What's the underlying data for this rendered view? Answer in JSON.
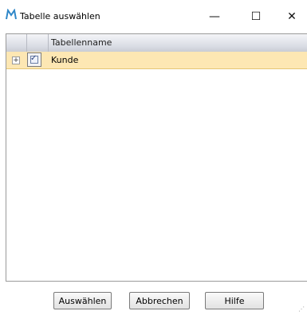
{
  "window": {
    "title": "Tabelle auswählen",
    "controls": {
      "minimize": "—",
      "maximize": "☐",
      "close": "✕"
    }
  },
  "grid": {
    "columns": [
      "",
      "",
      "Tabellenname"
    ],
    "rows": [
      {
        "expander": "+",
        "checked": true,
        "checkmark": "✓",
        "name": "Kunde"
      }
    ]
  },
  "buttons": {
    "select": "Auswählen",
    "cancel": "Abbrechen",
    "help": "Hilfe"
  },
  "colors": {
    "selected_row": "#fde7b3",
    "header_gradient": "#d9dce4",
    "app_icon": "#2f87c8"
  }
}
